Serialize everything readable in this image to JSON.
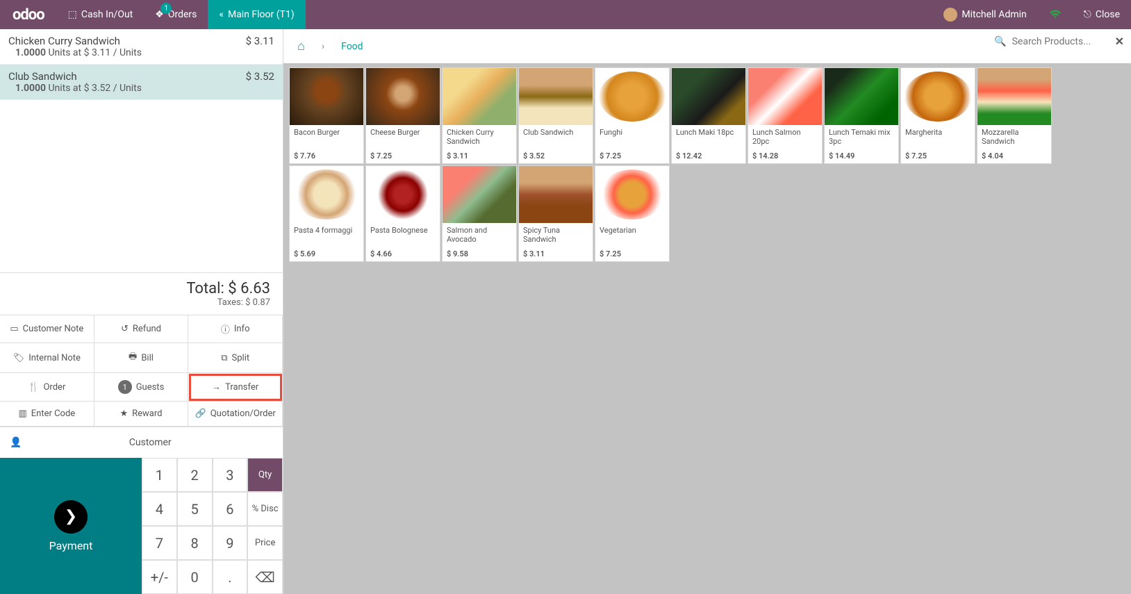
{
  "topbar": {
    "logo": "odoo",
    "cashInOut": "Cash In/Out",
    "orders": "Orders",
    "ordersBadge": "1",
    "floorLabel": "Main Floor  (T1)",
    "userName": "Mitchell Admin",
    "close": "Close"
  },
  "orderlines": [
    {
      "name": "Chicken Curry Sandwich",
      "price": "$ 3.11",
      "qty": "1.0000",
      "unitLabel": "Units at",
      "unitPrice": "$ 3.11 / Units",
      "selected": false
    },
    {
      "name": "Club Sandwich",
      "price": "$ 3.52",
      "qty": "1.0000",
      "unitLabel": "Units at",
      "unitPrice": "$ 3.52 / Units",
      "selected": true
    }
  ],
  "summary": {
    "totalLabel": "Total:",
    "totalValue": "$ 6.63",
    "taxesLabel": "Taxes:",
    "taxesValue": "$ 0.87"
  },
  "controls": {
    "customerNote": "Customer Note",
    "refund": "Refund",
    "info": "Info",
    "internalNote": "Internal Note",
    "bill": "Bill",
    "split": "Split",
    "order": "Order",
    "guests": "Guests",
    "guestsCount": "1",
    "transfer": "Transfer",
    "enterCode": "Enter Code",
    "reward": "Reward",
    "quotation": "Quotation/Order"
  },
  "customer": {
    "label": "Customer"
  },
  "numpad": {
    "keys": [
      "1",
      "2",
      "3",
      "4",
      "5",
      "6",
      "7",
      "8",
      "9",
      "+/-",
      "0",
      "."
    ],
    "qty": "Qty",
    "disc": "% Disc",
    "price": "Price",
    "backspace": "⌫"
  },
  "payment": {
    "label": "Payment"
  },
  "breadcrumb": {
    "category": "Food"
  },
  "search": {
    "placeholder": "Search Products..."
  },
  "products": [
    {
      "name": "Bacon Burger",
      "price": "$ 7.76",
      "img": "pi-burger1"
    },
    {
      "name": "Cheese Burger",
      "price": "$ 7.25",
      "img": "pi-burger2"
    },
    {
      "name": "Chicken Curry Sandwich",
      "price": "$ 3.11",
      "img": "pi-sandwich-illust"
    },
    {
      "name": "Club Sandwich",
      "price": "$ 3.52",
      "img": "pi-club"
    },
    {
      "name": "Funghi",
      "price": "$ 7.25",
      "img": "pi-pizza1"
    },
    {
      "name": "Lunch Maki 18pc",
      "price": "$ 12.42",
      "img": "pi-maki"
    },
    {
      "name": "Lunch Salmon 20pc",
      "price": "$ 14.28",
      "img": "pi-salmon"
    },
    {
      "name": "Lunch Temaki mix 3pc",
      "price": "$ 14.49",
      "img": "pi-temaki"
    },
    {
      "name": "Margherita",
      "price": "$ 7.25",
      "img": "pi-pizza2"
    },
    {
      "name": "Mozzarella Sandwich",
      "price": "$ 4.04",
      "img": "pi-mozz"
    },
    {
      "name": "Pasta 4 formaggi",
      "price": "$ 5.69",
      "img": "pi-pasta1"
    },
    {
      "name": "Pasta Bolognese",
      "price": "$ 4.66",
      "img": "pi-pasta2"
    },
    {
      "name": "Salmon and Avocado",
      "price": "$ 9.58",
      "img": "pi-avo"
    },
    {
      "name": "Spicy Tuna Sandwich",
      "price": "$ 3.11",
      "img": "pi-tuna"
    },
    {
      "name": "Vegetarian",
      "price": "$ 7.25",
      "img": "pi-veg"
    }
  ]
}
